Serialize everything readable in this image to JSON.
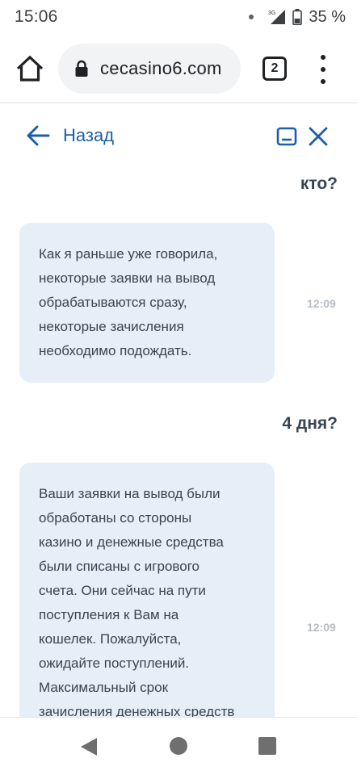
{
  "status_bar": {
    "time": "15:06",
    "network_label": "3G",
    "battery": "35 %"
  },
  "browser": {
    "url": "cecasino6.com",
    "tab_count": "2",
    "icons": [
      "home-icon",
      "lock-icon",
      "tabs-icon",
      "menu-icon"
    ]
  },
  "chat_header": {
    "back_label": "Назад",
    "icons": [
      "arrow-left-icon",
      "minimize-icon",
      "close-icon"
    ],
    "accent_color": "#1c5fa8"
  },
  "messages": [
    {
      "from": "user",
      "text": "кто?"
    },
    {
      "from": "agent",
      "text": "Как я раньше уже говорила,\nнекоторые заявки на вывод\nобрабатываются сразу,\nнекоторые зачисления\nнеобходимо подождать.",
      "time": "12:09"
    },
    {
      "from": "user",
      "text": "4 дня?"
    },
    {
      "from": "agent",
      "text": "Ваши заявки на вывод были\nобработаны со стороны\nказино и денежные средства\nбыли списаны с игрового\nсчета. Они сейчас на пути\nпоступления к Вам на\nкошелек. Пожалуйста,\nожидайте поступлений.\nМаксимальный срок\nзачисления денежных средств",
      "time": "12:09"
    }
  ],
  "colors": {
    "agent_bubble": "#e6eef7",
    "user_text": "#3a4553",
    "time_text": "#b5bcc5"
  },
  "nav_bar": {
    "icons": [
      "nav-back-icon",
      "nav-home-icon",
      "nav-recent-icon"
    ]
  }
}
